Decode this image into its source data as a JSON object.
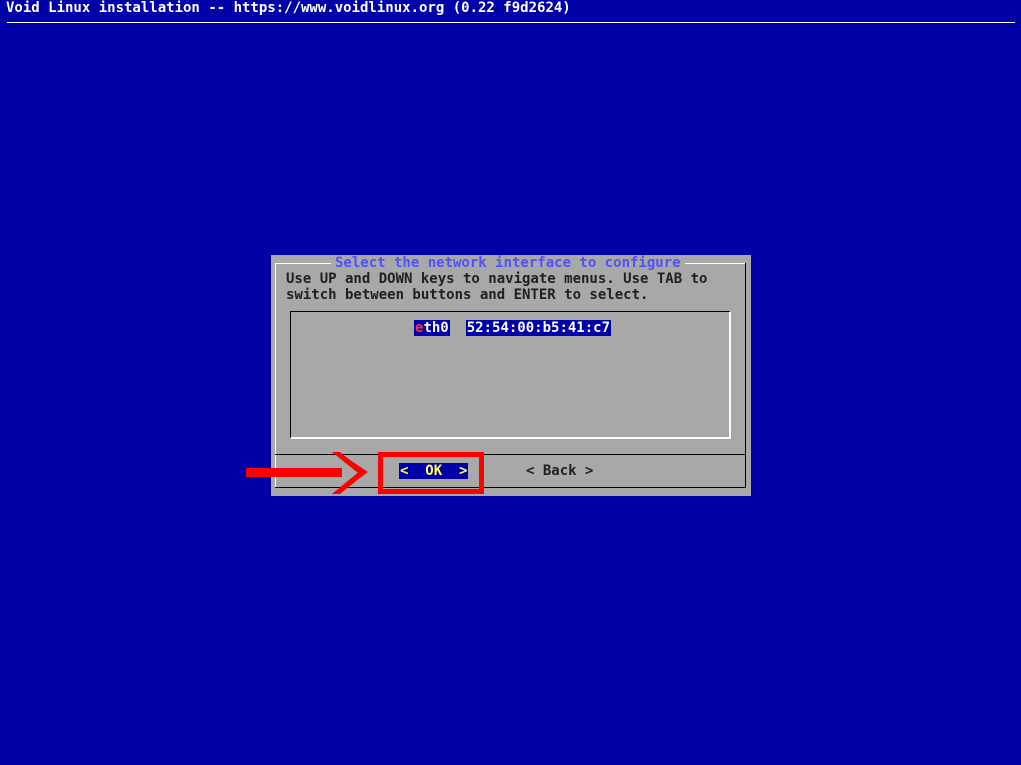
{
  "backtitle": "Void Linux installation -- https://www.voidlinux.org (0.22 f9d2624)",
  "dialog": {
    "title": "Select the network interface to configure",
    "prompt_line1": "Use UP and DOWN keys to navigate menus. Use TAB to",
    "prompt_line2": "switch between buttons and ENTER to select.",
    "menu": {
      "items": [
        {
          "tag_hotkey": "e",
          "tag_rest": "th0",
          "description": "52:54:00:b5:41:c7",
          "selected": true
        }
      ]
    },
    "buttons": {
      "ok_label": "<  OK  >",
      "back_label": "< Back >"
    }
  },
  "colors": {
    "background": "#0000a8",
    "dialog": "#a8a8a8",
    "title": "#5050ff",
    "highlight": "#ff0000"
  }
}
